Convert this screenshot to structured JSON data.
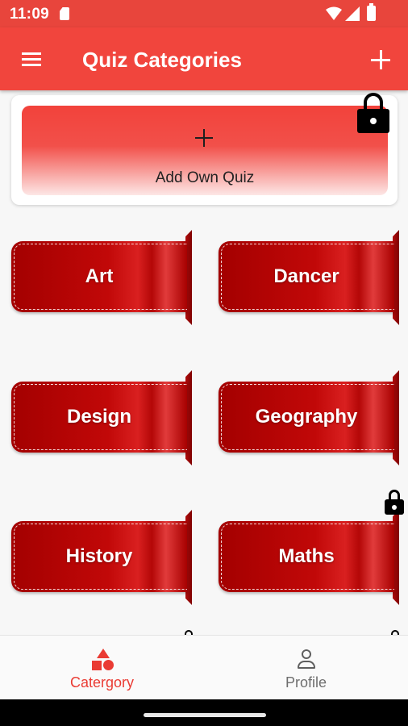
{
  "status_bar": {
    "time": "11:09"
  },
  "app_bar": {
    "title": "Quiz Categories"
  },
  "own_quiz": {
    "label": "Add Own Quiz",
    "locked": true
  },
  "categories": [
    {
      "label": "Art",
      "locked": false
    },
    {
      "label": "Dancer",
      "locked": false
    },
    {
      "label": "Design",
      "locked": false
    },
    {
      "label": "Geography",
      "locked": false
    },
    {
      "label": "History",
      "locked": false
    },
    {
      "label": "Maths",
      "locked": true
    }
  ],
  "bottom_nav": {
    "items": [
      {
        "label": "Catergory",
        "icon": "category-shapes-icon",
        "active": true
      },
      {
        "label": "Profile",
        "icon": "person-icon",
        "active": false
      }
    ]
  },
  "colors": {
    "accent": "#f1453d",
    "status_bar": "#e8453c",
    "ribbon": "#c10808",
    "active_nav": "#ea3b33",
    "inactive_nav": "#6e6e6e"
  }
}
